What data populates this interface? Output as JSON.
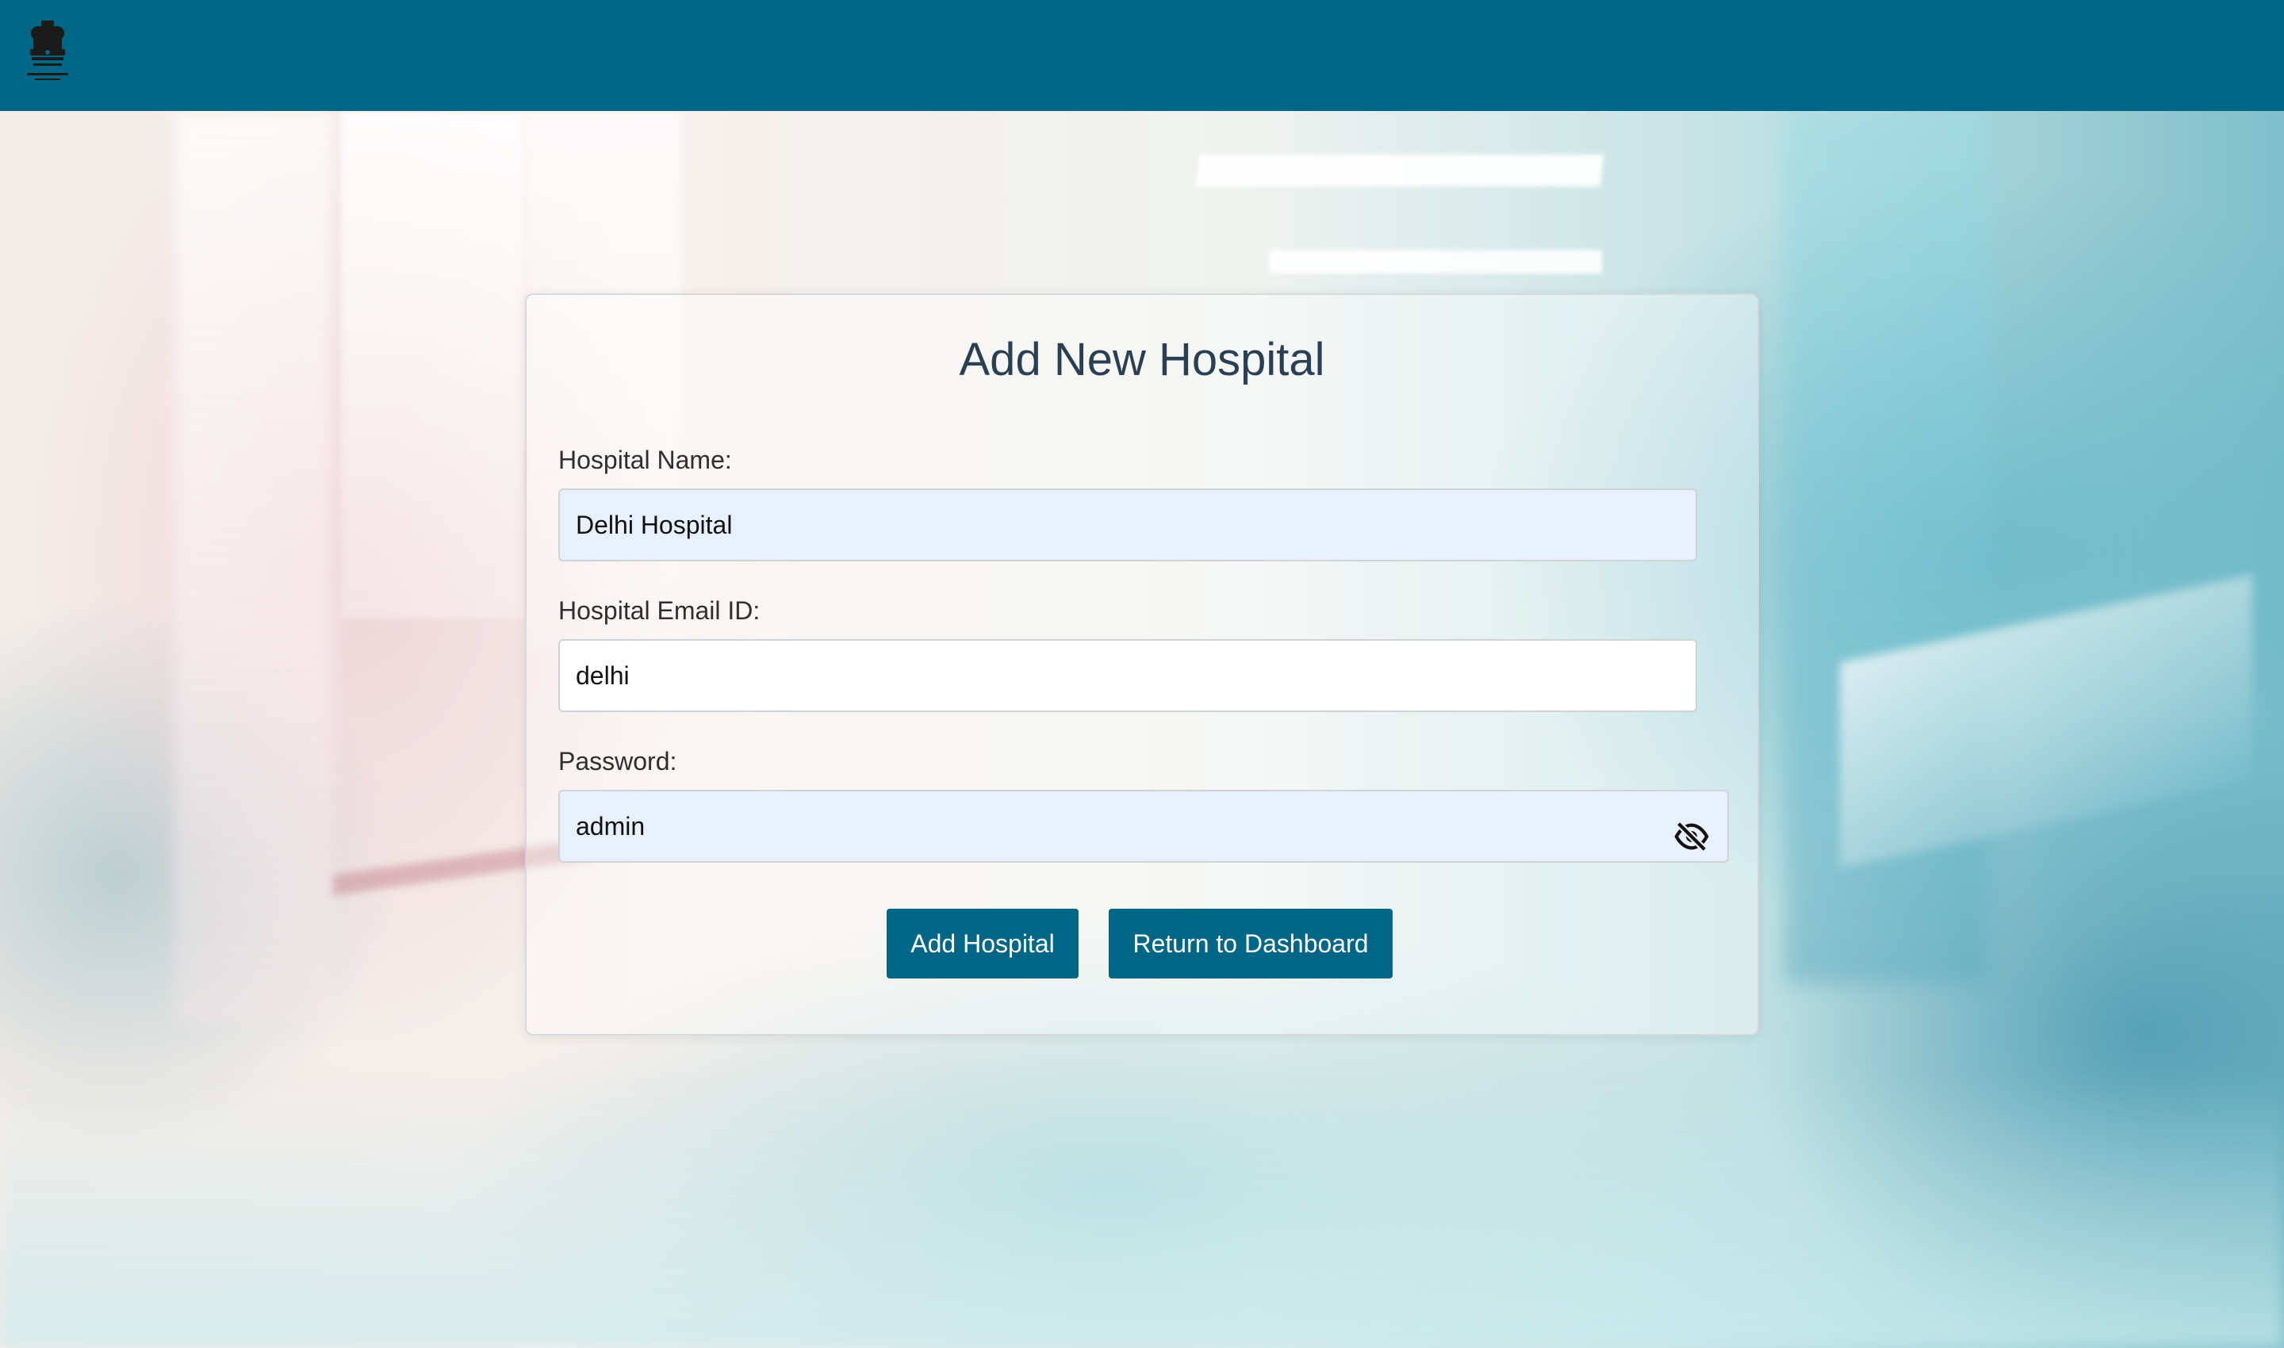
{
  "header": {
    "logo_icon": "national-emblem-icon",
    "background_color": "#006686"
  },
  "form": {
    "title": "Add New Hospital",
    "hospital_name": {
      "label": "Hospital Name:",
      "value": "Delhi Hospital"
    },
    "hospital_email": {
      "label": "Hospital Email ID:",
      "value": "delhi"
    },
    "password": {
      "label": "Password:",
      "value": "admin",
      "toggle_icon": "eye-slash-icon"
    },
    "buttons": {
      "add_label": "Add Hospital",
      "return_label": "Return to Dashboard"
    }
  },
  "colors": {
    "accent": "#006686",
    "autofill_background": "#e8f0fe",
    "title_text": "#2b3f52"
  }
}
